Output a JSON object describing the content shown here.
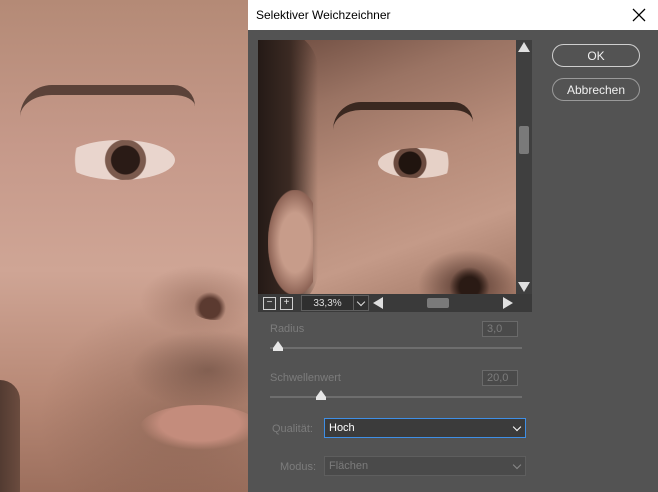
{
  "dialog": {
    "title": "Selektiver Weichzeichner",
    "close_icon": "close-icon"
  },
  "preview": {
    "zoom_value": "33,3%",
    "zoom_out_glyph": "−",
    "zoom_in_glyph": "+"
  },
  "buttons": {
    "ok_label": "OK",
    "cancel_label": "Abbrechen"
  },
  "params": {
    "radius_label": "Radius",
    "radius_value": "3,0",
    "radius_fraction": 0.03,
    "threshold_label": "Schwellenwert",
    "threshold_value": "20,0",
    "threshold_fraction": 0.2
  },
  "quality": {
    "label": "Qualität:",
    "selected": "Hoch"
  },
  "mode": {
    "label": "Modus:",
    "selected": "Flächen"
  },
  "colors": {
    "dialog_bg": "#535353",
    "focus_blue": "#3f8fe6"
  }
}
